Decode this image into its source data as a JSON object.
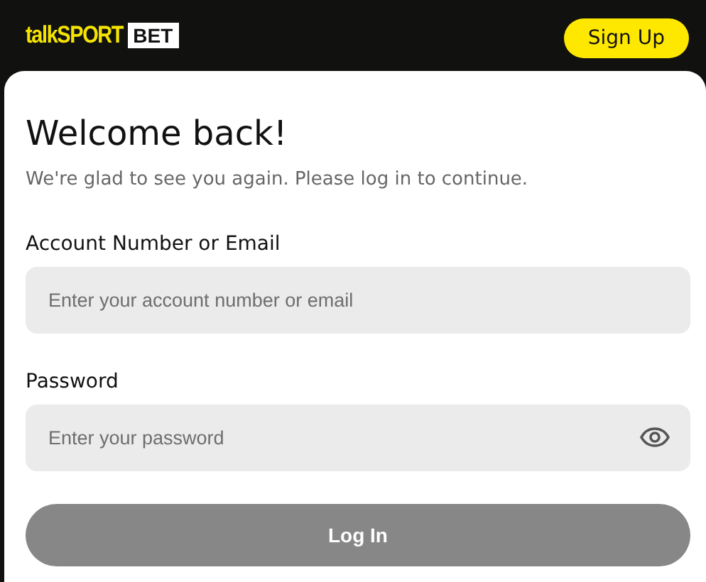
{
  "header": {
    "logo": {
      "brand": "talkSPORT",
      "badge": "BET"
    },
    "signup_button": "Sign Up"
  },
  "login": {
    "title": "Welcome back!",
    "subtitle": "We're glad to see you again. Please log in to continue.",
    "fields": [
      {
        "label": "Account Number or Email",
        "placeholder": "Enter your account number or email",
        "kind": "text"
      },
      {
        "label": "Password",
        "placeholder": "Enter your password",
        "kind": "password"
      }
    ],
    "submit": {
      "label": "Log In",
      "disabled": true
    }
  }
}
